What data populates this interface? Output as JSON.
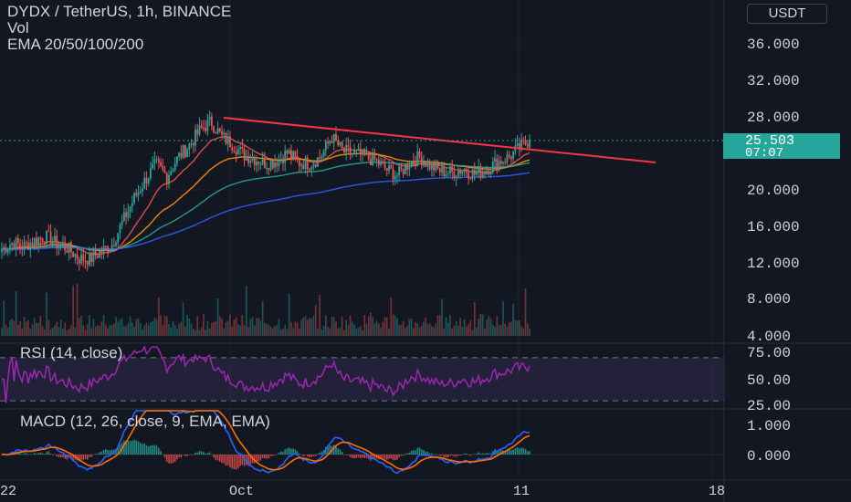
{
  "header": {
    "title": "DYDX / TetherUS, 1h, BINANCE",
    "volume_label": "Vol",
    "ema_label": "EMA 20/50/100/200",
    "currency": "USDT"
  },
  "price_axis": {
    "labels": [
      "36.000",
      "32.000",
      "28.000",
      "20.000",
      "16.000",
      "12.000",
      "8.000",
      "4.000"
    ]
  },
  "last_price": {
    "value": "25.503",
    "countdown": "07:07"
  },
  "rsi": {
    "label": "RSI (14, close)",
    "axis_labels": [
      "75.00",
      "50.00",
      "25.00"
    ]
  },
  "macd": {
    "label": "MACD (12, 26, close, 9, EMA, EMA)",
    "axis_labels": [
      "1.000",
      "0.000"
    ]
  },
  "time_axis": {
    "labels": [
      "22",
      "Oct",
      "11",
      "18"
    ]
  },
  "colors": {
    "background": "#131722",
    "up": "#26a69a",
    "down": "#ef5350",
    "rsi": "#9c27b0",
    "macd": "#2962ff",
    "signal": "#ff6d00",
    "trendline": "#f23645"
  },
  "chart_data": {
    "type": "candlestick",
    "symbol": "DYDX / TetherUS",
    "interval": "1h",
    "exchange": "BINANCE",
    "y_range": [
      4,
      38
    ],
    "close_series_approx": [
      13.5,
      14.2,
      13.8,
      14.5,
      14.9,
      14.1,
      13.6,
      12.5,
      12.4,
      13.2,
      14.0,
      16.5,
      19.0,
      21.0,
      22.8,
      21.5,
      23.5,
      24.8,
      26.5,
      27.5,
      25.8,
      25.0,
      23.8,
      23.4,
      22.9,
      23.2,
      24.1,
      23.0,
      22.9,
      23.6,
      25.8,
      24.2,
      24.0,
      23.6,
      23.2,
      22.2,
      21.6,
      22.9,
      23.6,
      22.6,
      22.0,
      21.9,
      22.3,
      21.7,
      22.2,
      23.0,
      23.5,
      24.5,
      25.5
    ],
    "last_price": 25.503,
    "rsi_levels": [
      30,
      70
    ]
  }
}
